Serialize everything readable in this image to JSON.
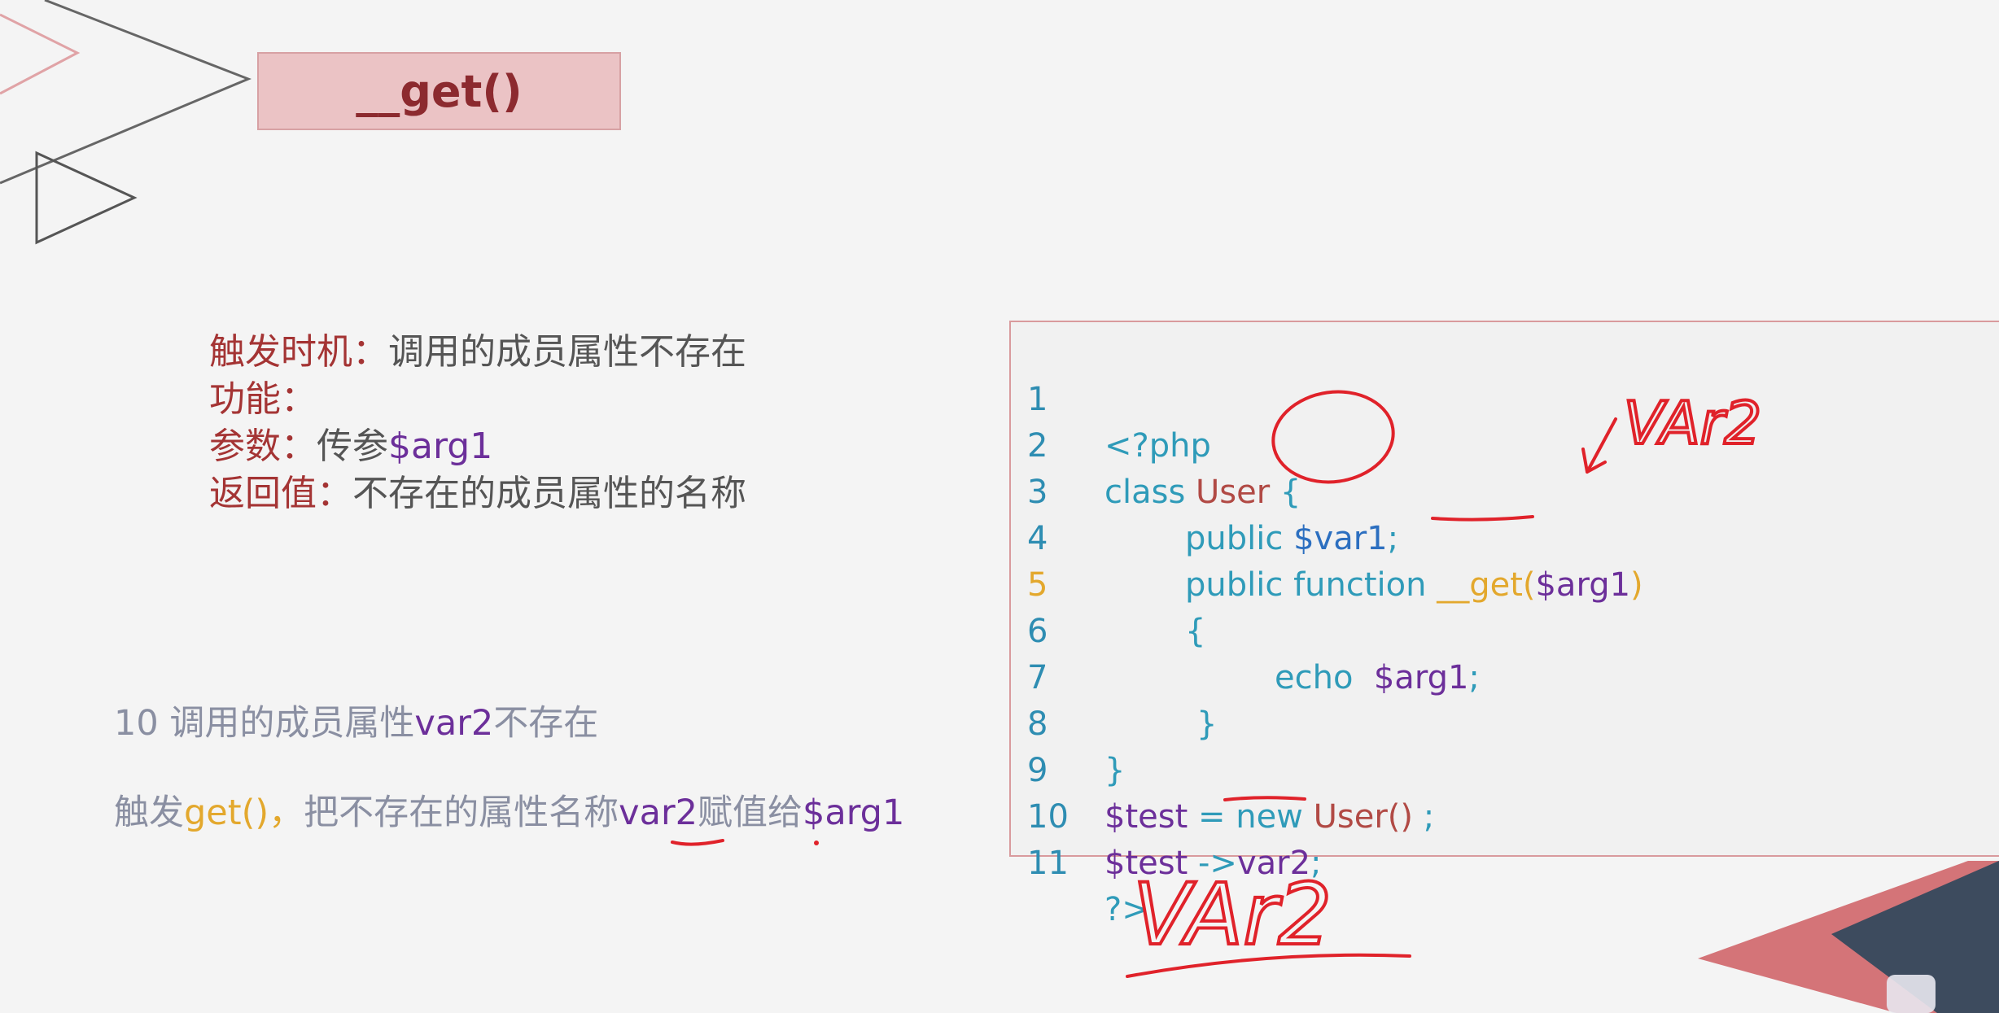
{
  "title": "__get()",
  "info": {
    "trigger_label": "触发时机",
    "trigger_value": "调用的成员属性不存在",
    "function_label": "功能",
    "function_value": "",
    "param_label": "参数",
    "param_prefix": "传参",
    "param_var": "$arg1",
    "return_label": "返回值",
    "return_value": "不存在的成员属性的名称",
    "colon": "："
  },
  "notes": {
    "line1_prefix": "10 调用的成员属性",
    "line1_var": "var2",
    "line1_suffix": "不存在",
    "line2_prefix": "触发",
    "line2_func": "get()",
    "line2_comma": "，",
    "line2_mid": "把不存在的属性名称",
    "line2_var": "var2",
    "line2_mid2": "赋值给",
    "line2_arg": "$arg1"
  },
  "code": {
    "line_numbers": [
      "1",
      "2",
      "3",
      "4",
      "5",
      "6",
      "7",
      "8",
      "9",
      "10",
      "11"
    ],
    "l1": "<?php",
    "l2_kw": "class ",
    "l2_name": "User",
    "l2_brace": " {",
    "l3_kw": "public ",
    "l3_var": "$var1",
    "l3_semi": ";",
    "l4_kw": "public function ",
    "l4_func": "__get(",
    "l4_arg": "$arg1",
    "l4_close": ")",
    "l5": "{",
    "l6_kw": "echo  ",
    "l6_arg": "$arg1",
    "l6_semi": ";",
    "l7": "}",
    "l8": "}",
    "l9_var": "$test",
    "l9_eq": " = ",
    "l9_new": "new ",
    "l9_cls": "User()",
    "l9_semi": " ;",
    "l10_var": "$test",
    "l10_arrow": " ->",
    "l10_prop": "var2",
    "l10_semi": ";",
    "l11": "?>"
  },
  "annotations": {
    "handwriting_top": "VAr2",
    "handwriting_bottom": "VAr2"
  },
  "colors": {
    "title_bg": "#ebc3c5",
    "label_red": "#a43434",
    "purple": "#6c2f9a",
    "orange": "#e3a82d",
    "teal": "#2f9bb9",
    "ink_red": "#e0222a",
    "navy": "#3d4b5e",
    "salmon": "#d47478"
  }
}
